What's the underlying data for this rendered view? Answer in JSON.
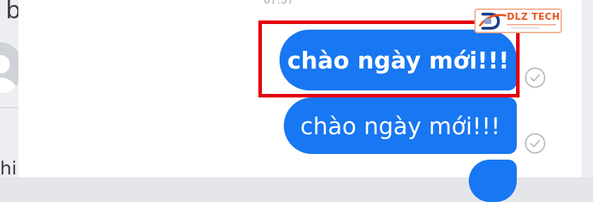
{
  "left_panel": {
    "top_partial_text": "b",
    "bottom_partial_text": "hi"
  },
  "chat": {
    "timestamp": "07:57",
    "messages": [
      {
        "text": "chào ngày mới!!!",
        "style": "bold",
        "highlighted": true,
        "status": "seen"
      },
      {
        "text": "chào ngày mới!!!",
        "style": "normal",
        "highlighted": false,
        "status": "seen"
      },
      {
        "text": "",
        "style": "normal",
        "highlighted": false,
        "status": ""
      }
    ]
  },
  "watermark": {
    "brand": "DLZ TECH",
    "icon": "dlz-logo-icon"
  },
  "colors": {
    "bubble": "#1877f2",
    "highlight": "#e3000f",
    "brand": "#e9551d"
  }
}
